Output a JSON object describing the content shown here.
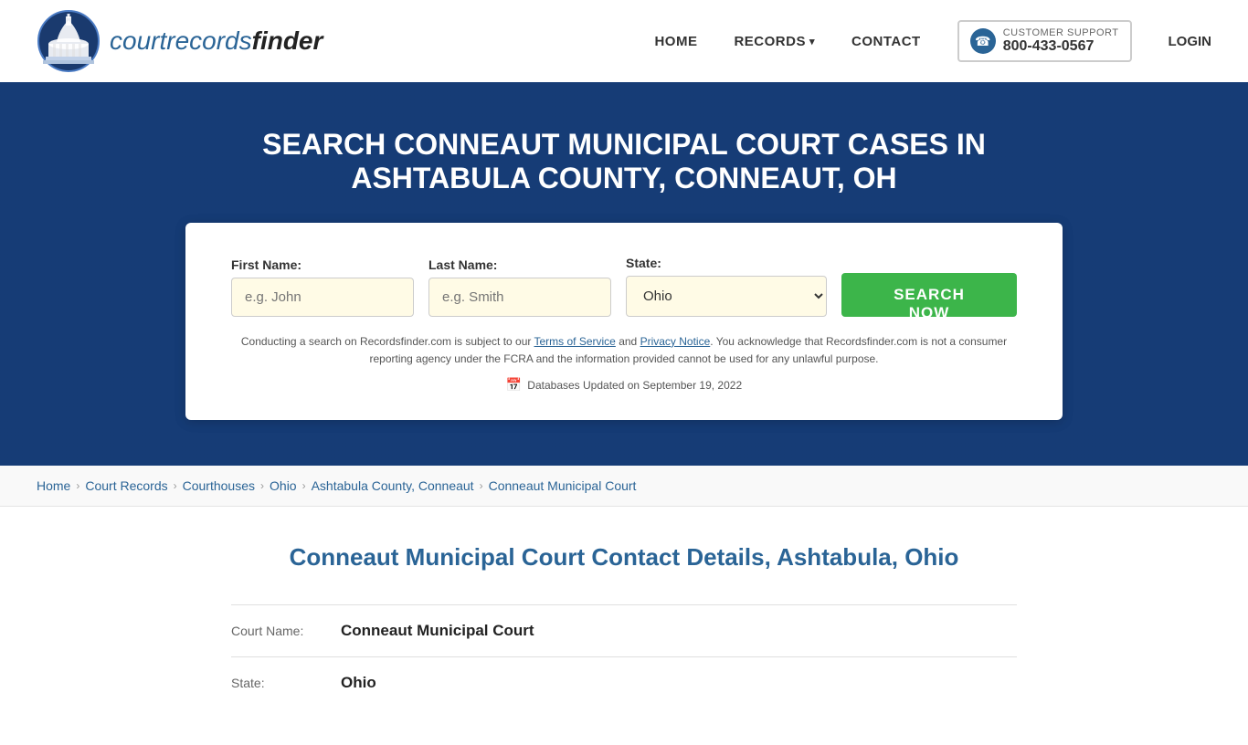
{
  "header": {
    "logo_text_normal": "courtrecords",
    "logo_text_bold": "finder",
    "nav": {
      "home_label": "HOME",
      "records_label": "RECORDS",
      "contact_label": "CONTACT",
      "login_label": "LOGIN",
      "support_label": "CUSTOMER SUPPORT",
      "support_number": "800-433-0567"
    }
  },
  "hero": {
    "title": "SEARCH CONNEAUT MUNICIPAL COURT CASES IN ASHTABULA COUNTY, CONNEAUT, OH",
    "form": {
      "first_name_label": "First Name:",
      "first_name_placeholder": "e.g. John",
      "last_name_label": "Last Name:",
      "last_name_placeholder": "e.g. Smith",
      "state_label": "State:",
      "state_value": "Ohio",
      "search_button_label": "SEARCH NOW"
    },
    "disclaimer": {
      "text_before": "Conducting a search on Recordsfinder.com is subject to our ",
      "tos_label": "Terms of Service",
      "text_mid": " and ",
      "privacy_label": "Privacy Notice",
      "text_after": ". You acknowledge that Recordsfinder.com is not a consumer reporting agency under the FCRA and the information provided cannot be used for any unlawful purpose."
    },
    "db_updated": "Databases Updated on September 19, 2022"
  },
  "breadcrumb": {
    "items": [
      {
        "label": "Home",
        "link": true
      },
      {
        "label": "Court Records",
        "link": true
      },
      {
        "label": "Courthouses",
        "link": true
      },
      {
        "label": "Ohio",
        "link": true
      },
      {
        "label": "Ashtabula County, Conneaut",
        "link": true
      },
      {
        "label": "Conneaut Municipal Court",
        "link": false
      }
    ]
  },
  "content": {
    "heading": "Conneaut Municipal Court Contact Details, Ashtabula, Ohio",
    "details": [
      {
        "label": "Court Name:",
        "value": "Conneaut Municipal Court"
      },
      {
        "label": "State:",
        "value": "Ohio"
      }
    ]
  }
}
